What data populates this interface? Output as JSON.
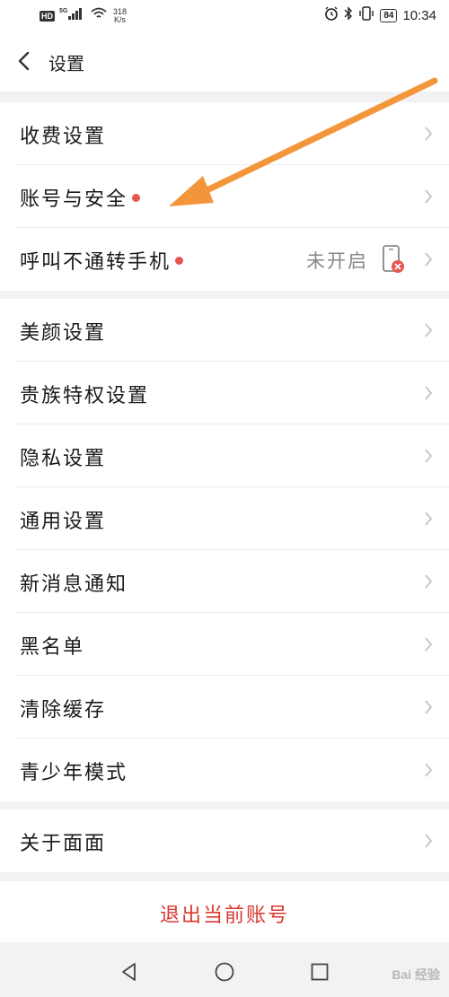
{
  "status_bar": {
    "hd": "HD",
    "network_type": "5G",
    "speed_value": "318",
    "speed_unit": "K/s",
    "battery": "84",
    "time": "10:34"
  },
  "header": {
    "title": "设置"
  },
  "groups": [
    {
      "items": [
        {
          "label": "收费设置"
        },
        {
          "label": "账号与安全",
          "dot": true
        },
        {
          "label": "呼叫不通转手机",
          "dot": true,
          "value": "未开启"
        }
      ]
    },
    {
      "items": [
        {
          "label": "美颜设置"
        },
        {
          "label": "贵族特权设置"
        },
        {
          "label": "隐私设置"
        },
        {
          "label": "通用设置"
        },
        {
          "label": "新消息通知"
        },
        {
          "label": "黑名单"
        },
        {
          "label": "清除缓存"
        },
        {
          "label": "青少年模式"
        }
      ]
    },
    {
      "items": [
        {
          "label": "关于面面"
        }
      ]
    }
  ],
  "logout_label": "退出当前账号",
  "watermark": "Bai 经验",
  "colors": {
    "accent_red": "#d9362e",
    "dot_red": "#e8554e",
    "annotation_arrow": "#f3953a"
  }
}
